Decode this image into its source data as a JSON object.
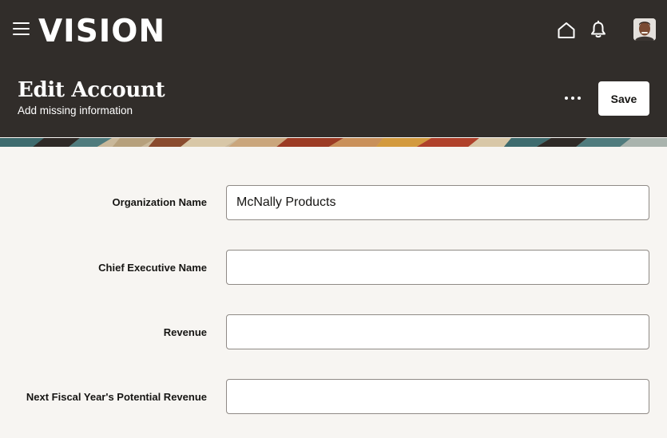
{
  "app": {
    "logo_text": "VISION",
    "colors": {
      "header_bg": "#312d2a",
      "page_bg": "#f7f5f2",
      "input_border": "#8f8a86"
    }
  },
  "topbar": {
    "icons": [
      "hamburger-menu-icon",
      "home-icon",
      "bell-icon",
      "user-avatar"
    ]
  },
  "page": {
    "title": "Edit Account",
    "subtitle": "Add missing information",
    "save_label": "Save",
    "more_icon": "more-horizontal-icon"
  },
  "form": {
    "fields": [
      {
        "label": "Organization Name",
        "value": "McNally Products"
      },
      {
        "label": "Chief Executive Name",
        "value": ""
      },
      {
        "label": "Revenue",
        "value": ""
      },
      {
        "label": "Next Fiscal Year's Potential Revenue",
        "value": ""
      }
    ]
  }
}
